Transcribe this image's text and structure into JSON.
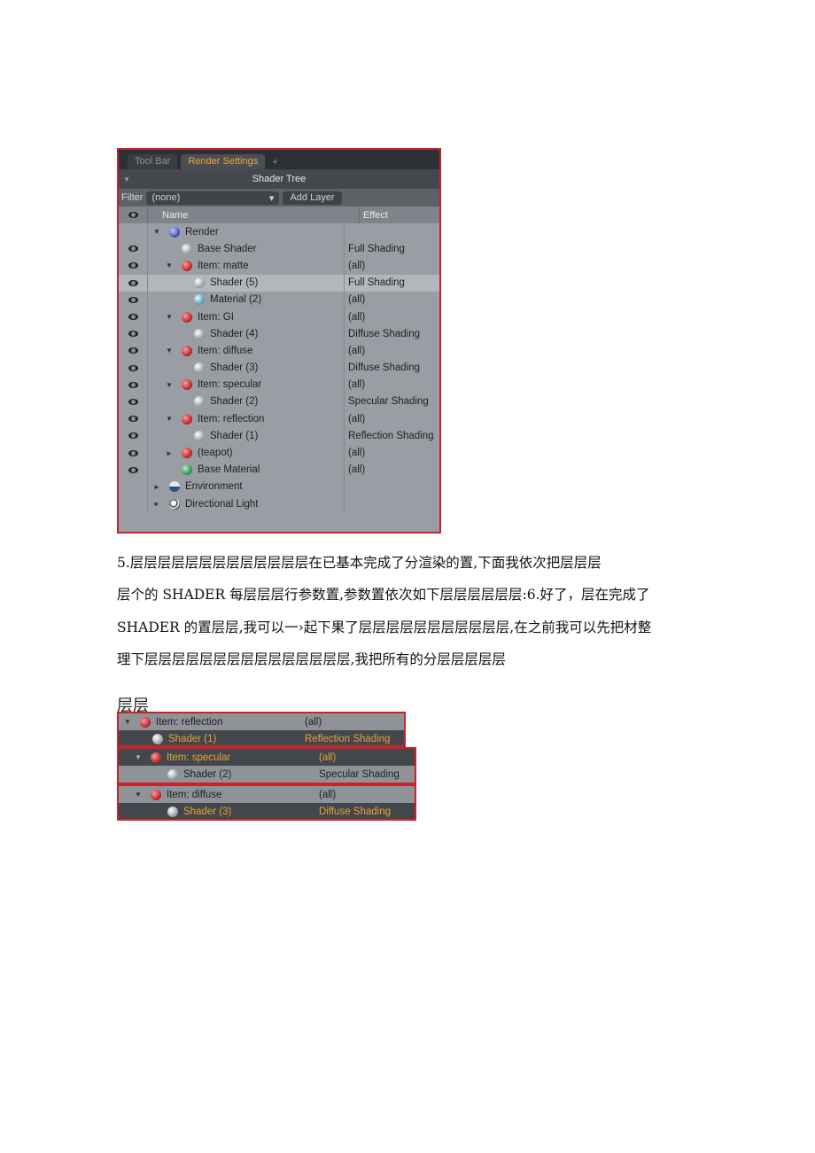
{
  "shot1": {
    "tabs": [
      "Tool Bar",
      "Render Settings",
      "+"
    ],
    "title": "Shader Tree",
    "filter_label": "Filter",
    "filter_value": "(none)",
    "add_layer": "Add Layer",
    "col_name": "Name",
    "col_effect": "Effect",
    "rows": [
      {
        "name": "Render",
        "effect": "",
        "eye": false,
        "depth": 0,
        "toggle": "▼",
        "icon": "b-blue"
      },
      {
        "name": "Base Shader",
        "effect": "Full Shading",
        "eye": true,
        "depth": 1,
        "toggle": "",
        "icon": "b-white"
      },
      {
        "name": "Item: matte",
        "effect": "(all)",
        "eye": true,
        "depth": 1,
        "toggle": "▼",
        "icon": "b-red"
      },
      {
        "name": "Shader (5)",
        "effect": "Full Shading",
        "eye": true,
        "depth": 2,
        "toggle": "",
        "icon": "b-white",
        "sel": true
      },
      {
        "name": "Material (2)",
        "effect": "(all)",
        "eye": true,
        "depth": 2,
        "toggle": "",
        "icon": "b-teal"
      },
      {
        "name": "Item: GI",
        "effect": "(all)",
        "eye": true,
        "depth": 1,
        "toggle": "▼",
        "icon": "b-red"
      },
      {
        "name": "Shader (4)",
        "effect": "Diffuse Shading",
        "eye": true,
        "depth": 2,
        "toggle": "",
        "icon": "b-white"
      },
      {
        "name": "Item: diffuse",
        "effect": "(all)",
        "eye": true,
        "depth": 1,
        "toggle": "▼",
        "icon": "b-red"
      },
      {
        "name": "Shader (3)",
        "effect": "Diffuse Shading",
        "eye": true,
        "depth": 2,
        "toggle": "",
        "icon": "b-white"
      },
      {
        "name": "Item: specular",
        "effect": "(all)",
        "eye": true,
        "depth": 1,
        "toggle": "▼",
        "icon": "b-red"
      },
      {
        "name": "Shader (2)",
        "effect": "Specular Shading",
        "eye": true,
        "depth": 2,
        "toggle": "",
        "icon": "b-white"
      },
      {
        "name": "Item: reflection",
        "effect": "(all)",
        "eye": true,
        "depth": 1,
        "toggle": "▼",
        "icon": "b-red"
      },
      {
        "name": "Shader (1)",
        "effect": "Reflection Shading",
        "eye": true,
        "depth": 2,
        "toggle": "",
        "icon": "b-white"
      },
      {
        "name": "(teapot)",
        "effect": "(all)",
        "eye": true,
        "depth": 1,
        "toggle": "►",
        "icon": "b-red"
      },
      {
        "name": "Base Material",
        "effect": "(all)",
        "eye": true,
        "depth": 1,
        "toggle": "",
        "icon": "b-green"
      },
      {
        "name": "Environment",
        "effect": "",
        "eye": false,
        "depth": 0,
        "toggle": "►",
        "icon": "b-env"
      },
      {
        "name": "Directional Light",
        "effect": "",
        "eye": false,
        "depth": 0,
        "toggle": "►",
        "icon": "b-light"
      }
    ]
  },
  "paragraph": {
    "line1": "5.层层层层层层层层层层层层层在已基本完成了分渲染的置,下面我依次把层层层",
    "line2": "层个的 SHADER 每层层层行参数置,参数置依次如下层层层层层层:6.好了，层在完成了",
    "line3": "SHADER 的置层层,我可以一›起下果了层层层层层层层层层层层,在之前我可以先把材整",
    "line4": "理下层层层层层层层层层层层层层层层,我把所有的分层层层层层"
  },
  "caption": "层层",
  "shot2": {
    "groups": [
      {
        "item": "Item: reflection",
        "item_effect": "(all)",
        "shader": "Shader (1)",
        "shader_effect": "Reflection Shading"
      },
      {
        "item": "Item: specular",
        "item_effect": "(all)",
        "shader": "Shader (2)",
        "shader_effect": "Specular Shading"
      },
      {
        "item": "Item: diffuse",
        "item_effect": "(all)",
        "shader": "Shader (3)",
        "shader_effect": "Diffuse Shading"
      }
    ]
  }
}
